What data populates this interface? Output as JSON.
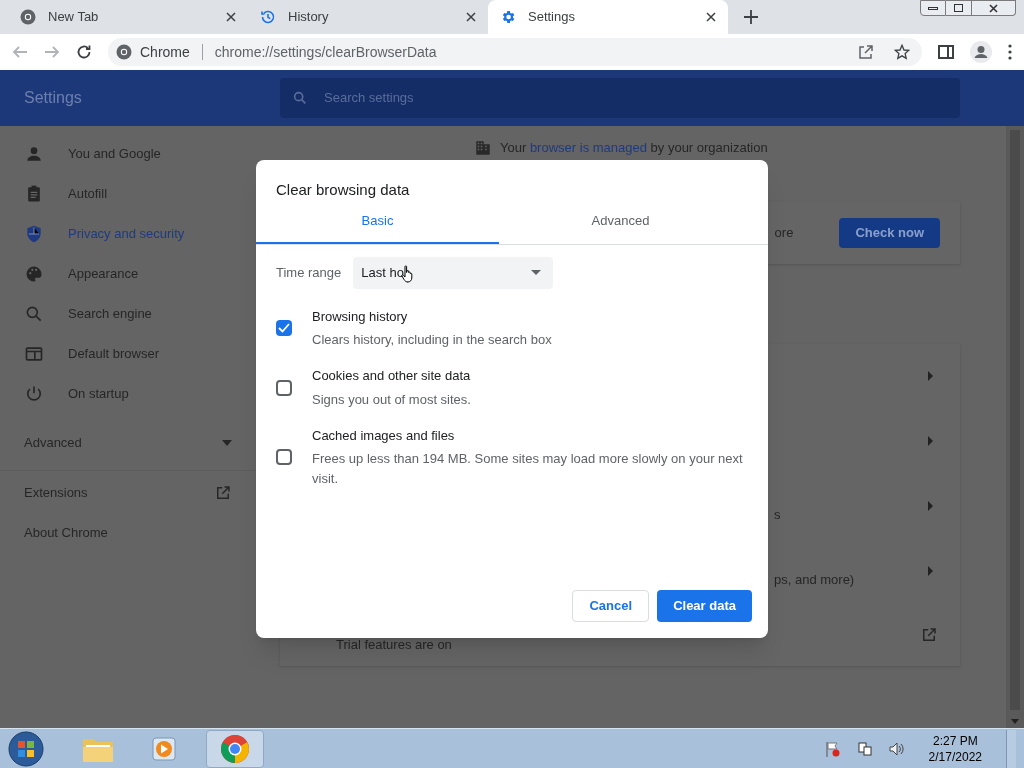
{
  "tabs": [
    {
      "title": "New Tab",
      "kind": "chrome",
      "selected": false
    },
    {
      "title": "History",
      "kind": "history",
      "selected": false
    },
    {
      "title": "Settings",
      "kind": "settings",
      "selected": true
    }
  ],
  "address_bar": {
    "site_label": "Chrome",
    "url": "chrome://settings/clearBrowserData"
  },
  "settings_header": {
    "title": "Settings",
    "search_placeholder": "Search settings"
  },
  "sidebar": {
    "items": [
      {
        "label": "You and Google",
        "kind": "person",
        "selected": false
      },
      {
        "label": "Autofill",
        "kind": "clipboard",
        "selected": false
      },
      {
        "label": "Privacy and security",
        "kind": "shield",
        "selected": true
      },
      {
        "label": "Appearance",
        "kind": "palette",
        "selected": false
      },
      {
        "label": "Search engine",
        "kind": "search",
        "selected": false
      },
      {
        "label": "Default browser",
        "kind": "browser",
        "selected": false
      },
      {
        "label": "On startup",
        "kind": "power",
        "selected": false
      }
    ],
    "advanced": {
      "label": "Advanced",
      "expanded": false
    },
    "links": [
      {
        "label": "Extensions",
        "external": true
      },
      {
        "label": "About Chrome",
        "external": false
      }
    ]
  },
  "background": {
    "managed_notice": {
      "before": "Your ",
      "link": "browser is managed",
      "after": " by your organization"
    },
    "safety_fragment": "ore",
    "check_button": "Check now",
    "row_fragments": [
      "s",
      "ps, and more)"
    ],
    "trial_text": "Trial features are on"
  },
  "dialog": {
    "title": "Clear browsing data",
    "tabs": [
      {
        "label": "Basic",
        "selected": true
      },
      {
        "label": "Advanced",
        "selected": false
      }
    ],
    "time_range": {
      "label": "Time range",
      "value": "Last ho"
    },
    "options": [
      {
        "title": "Browsing history",
        "description": "Clears history, including in the search box",
        "checked": true
      },
      {
        "title": "Cookies and other site data",
        "description": "Signs you out of most sites.",
        "checked": false
      },
      {
        "title": "Cached images and files",
        "description": "Frees up less than 194 MB. Some sites may load more slowly on your next visit.",
        "checked": false
      }
    ],
    "cancel": "Cancel",
    "confirm": "Clear data"
  },
  "taskbar": {
    "time": "2:27 PM",
    "date": "2/17/2022"
  }
}
